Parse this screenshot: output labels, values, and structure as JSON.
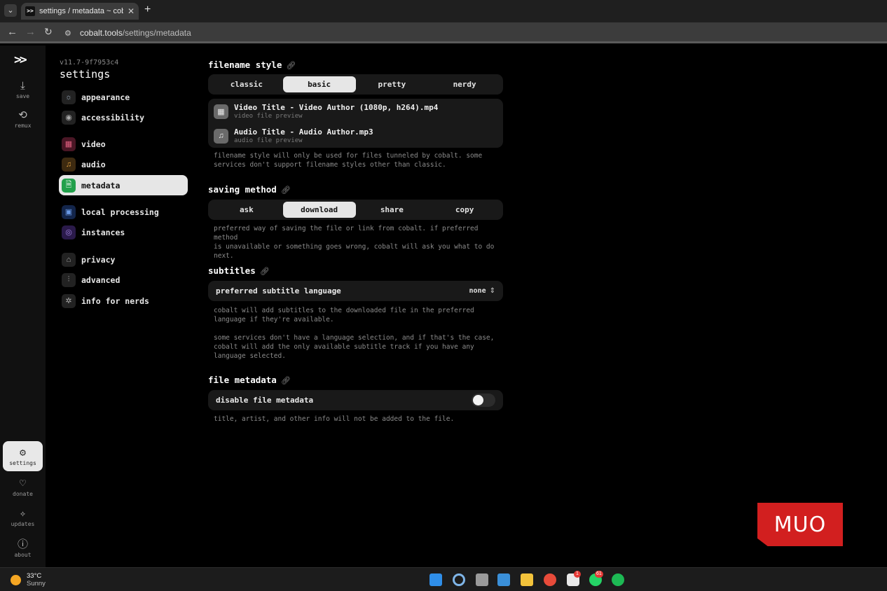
{
  "browser": {
    "tab_title": "settings / metadata ~ cobalt",
    "tab_close": "✕",
    "new_tab": "+",
    "favicon": ">>",
    "url_domain": "cobalt.tools",
    "url_path": "/settings/metadata"
  },
  "rail": {
    "logo": ">>",
    "items": [
      {
        "label": "save",
        "icon": "download-icon"
      },
      {
        "label": "remux",
        "icon": "remux-icon"
      },
      {
        "label": "settings",
        "icon": "gear-icon"
      },
      {
        "label": "donate",
        "icon": "heart-icon"
      },
      {
        "label": "updates",
        "icon": "sparkle-icon"
      },
      {
        "label": "about",
        "icon": "info-icon"
      }
    ]
  },
  "settings_nav": {
    "version": "v11.7-9f7953c4",
    "title": "settings",
    "items": [
      {
        "label": "appearance",
        "icon": "sun-icon",
        "color": "#2a2a2a"
      },
      {
        "label": "accessibility",
        "icon": "accessibility-icon",
        "color": "#2a2a2a"
      },
      {
        "label": "video",
        "icon": "film-icon",
        "color": "#4a1625"
      },
      {
        "label": "audio",
        "icon": "music-icon",
        "color": "#3d2a10"
      },
      {
        "label": "metadata",
        "icon": "file-settings-icon",
        "color": "#22a04b"
      },
      {
        "label": "local processing",
        "icon": "chip-icon",
        "color": "#13254a"
      },
      {
        "label": "instances",
        "icon": "globe-icon",
        "color": "#2a1a4a"
      },
      {
        "label": "privacy",
        "icon": "lock-icon",
        "color": "#2a2a2a"
      },
      {
        "label": "advanced",
        "icon": "sliders-icon",
        "color": "#2a2a2a"
      },
      {
        "label": "info for nerds",
        "icon": "bug-icon",
        "color": "#2a2a2a"
      }
    ]
  },
  "filename_style": {
    "title": "filename style",
    "options": [
      "classic",
      "basic",
      "pretty",
      "nerdy"
    ],
    "selected": "basic",
    "preview_video_name": "Video Title - Video Author (1080p, h264).mp4",
    "preview_video_sub": "video file preview",
    "preview_audio_name": "Audio Title - Audio Author.mp3",
    "preview_audio_sub": "audio file preview",
    "desc_1": "filename style will only be used for files tunneled by cobalt. some",
    "desc_2": "services don't support filename styles other than classic."
  },
  "saving_method": {
    "title": "saving method",
    "options": [
      "ask",
      "download",
      "share",
      "copy"
    ],
    "selected": "download",
    "desc_1": "preferred way of saving the file or link from cobalt. if preferred method",
    "desc_2": "is unavailable or something goes wrong, cobalt will ask you what to do",
    "desc_3": "next."
  },
  "subtitles": {
    "title": "subtitles",
    "row_label": "preferred subtitle language",
    "row_value": "none",
    "desc_1": "cobalt will add subtitles to the downloaded file in the preferred",
    "desc_2": "language if they're available.",
    "desc_3": "some services don't have a language selection, and if that's the case,",
    "desc_4": "cobalt will add the only available subtitle track if you have any",
    "desc_5": "language selected."
  },
  "file_metadata": {
    "title": "file metadata",
    "row_label": "disable file metadata",
    "toggle_on": false,
    "desc_1": "title, artist, and other info will not be added to the file."
  },
  "watermark": "MUO",
  "taskbar": {
    "temp": "33°C",
    "condition": "Sunny",
    "badge_slack": "1",
    "badge_whatsapp": "61"
  }
}
